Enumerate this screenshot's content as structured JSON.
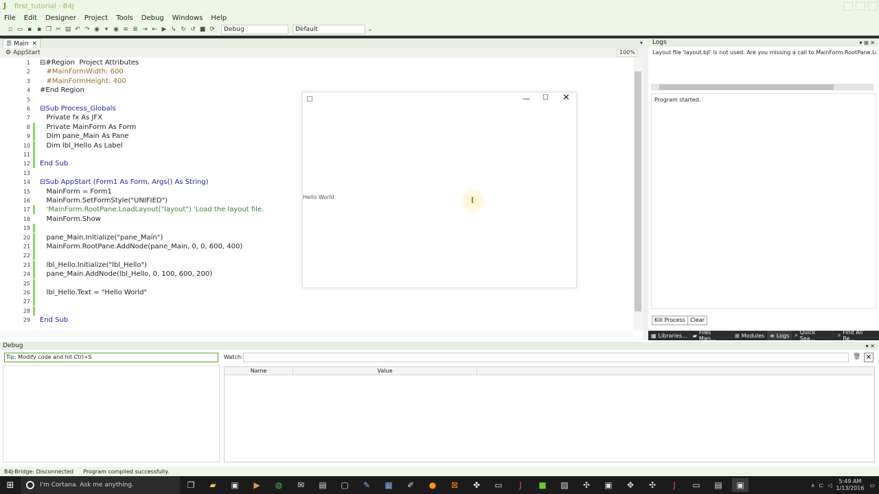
{
  "window": {
    "title": "first_tutorial - B4J"
  },
  "menu": [
    "File",
    "Edit",
    "Designer",
    "Project",
    "Tools",
    "Debug",
    "Windows",
    "Help"
  ],
  "toolbar": {
    "build_config": "Debug",
    "profile": "Default"
  },
  "editor": {
    "tab_label": "Main",
    "sub_combo": "AppStart",
    "zoom": "100%",
    "lines": [
      {
        "n": "1",
        "text": "⊟#Region  Project Attributes"
      },
      {
        "n": "2",
        "text": "   #MainFormWidth: 600"
      },
      {
        "n": "3",
        "text": "   #MainFormHeight: 400"
      },
      {
        "n": "4",
        "text": "#End Region"
      },
      {
        "n": "5",
        "text": ""
      },
      {
        "n": "6",
        "text": "⊟Sub Process_Globals"
      },
      {
        "n": "7",
        "text": "   Private fx As JFX"
      },
      {
        "n": "8",
        "text": "   Private MainForm As Form"
      },
      {
        "n": "9",
        "text": "   Dim pane_Main As Pane"
      },
      {
        "n": "10",
        "text": "   Dim lbl_Hello As Label"
      },
      {
        "n": "11",
        "text": ""
      },
      {
        "n": "12",
        "text": "End Sub"
      },
      {
        "n": "13",
        "text": ""
      },
      {
        "n": "14",
        "text": "⊟Sub AppStart (Form1 As Form, Args() As String)"
      },
      {
        "n": "15",
        "text": "   MainForm = Form1"
      },
      {
        "n": "16",
        "text": "   MainForm.SetFormStyle(\"UNIFIED\")"
      },
      {
        "n": "17",
        "text": "   'MainForm.RootPane.LoadLayout(\"layout\") 'Load the layout file."
      },
      {
        "n": "18",
        "text": "   MainForm.Show"
      },
      {
        "n": "19",
        "text": ""
      },
      {
        "n": "20",
        "text": "   pane_Main.Initialize(\"pane_Main\")"
      },
      {
        "n": "21",
        "text": "   MainForm.RootPane.AddNode(pane_Main, 0, 0, 600, 400)"
      },
      {
        "n": "22",
        "text": ""
      },
      {
        "n": "23",
        "text": "   lbl_Hello.Initialize(\"lbl_Hello\")"
      },
      {
        "n": "24",
        "text": "   pane_Main.AddNode(lbl_Hello, 0, 100, 600, 200)"
      },
      {
        "n": "25",
        "text": ""
      },
      {
        "n": "26",
        "text": "   lbl_Hello.Text = \"Hello World\""
      },
      {
        "n": "27",
        "text": ""
      },
      {
        "n": "28",
        "text": ""
      },
      {
        "n": "29",
        "text": "End Sub"
      }
    ]
  },
  "running_form": {
    "label": "Hello World"
  },
  "logs": {
    "title": "Logs",
    "message": "Layout file 'layout.bjl' is not used. Are you missing a call to MainForm.RootPane.LoadLayout",
    "output": "Program started.",
    "kill_button": "Kill Process",
    "clear_button": "Clear"
  },
  "right_tabs": [
    "Libraries...",
    "Files Man...",
    "Modules",
    "Logs",
    "Quick Sea...",
    "Find All Re..."
  ],
  "debug": {
    "title": "Debug",
    "tip": "Tip: Modify code and hit Ctrl+S",
    "watch_label": "Watch:",
    "col_name": "Name",
    "col_value": "Value"
  },
  "status": {
    "bridge": "B4J-Bridge: Disconnected",
    "compile": "Program compiled successfully."
  },
  "taskbar": {
    "cortana_placeholder": "I'm Cortana. Ask me anything.",
    "time": "5:49 AM",
    "date": "1/13/2016"
  },
  "colors": {
    "accent_green": "#5aa02c",
    "chrome": "#eef6e8",
    "taskbar": "#1b1b1b"
  }
}
